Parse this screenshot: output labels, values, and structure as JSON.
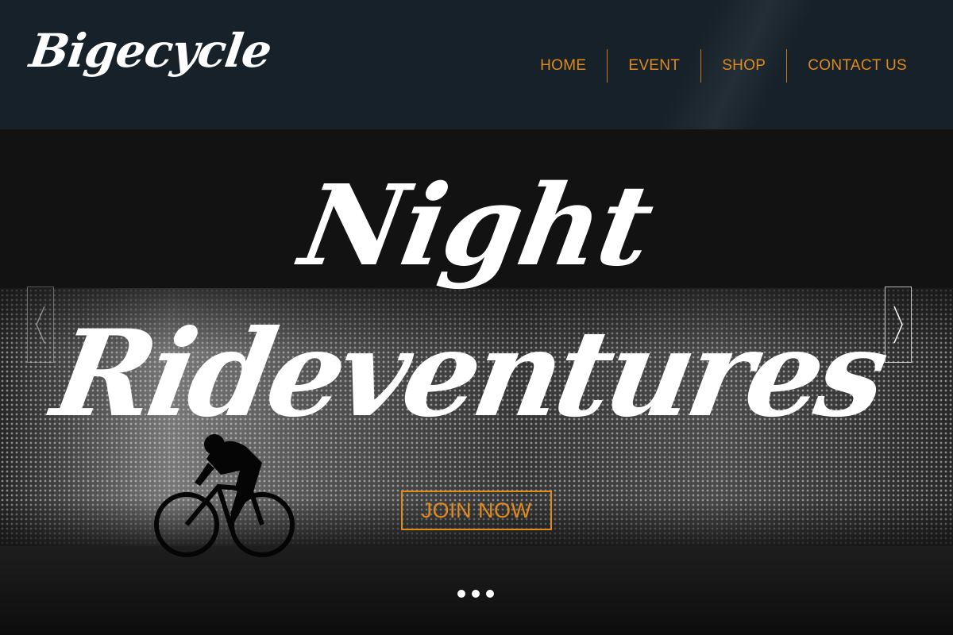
{
  "header": {
    "logo_text": "Bigecycle",
    "nav": [
      {
        "label": "HOME"
      },
      {
        "label": "EVENT"
      },
      {
        "label": "SHOP"
      },
      {
        "label": "CONTACT US"
      }
    ]
  },
  "hero": {
    "title_line1": "Night",
    "title_line2": "Rideventures",
    "cta_label": "JOIN NOW",
    "carousel": {
      "prev_icon": "chevron-left-icon",
      "next_icon": "chevron-right-icon",
      "slide_count": 3
    }
  },
  "colors": {
    "accent": "#e08a1e",
    "header_bg": "#16212a",
    "text": "#ffffff"
  }
}
